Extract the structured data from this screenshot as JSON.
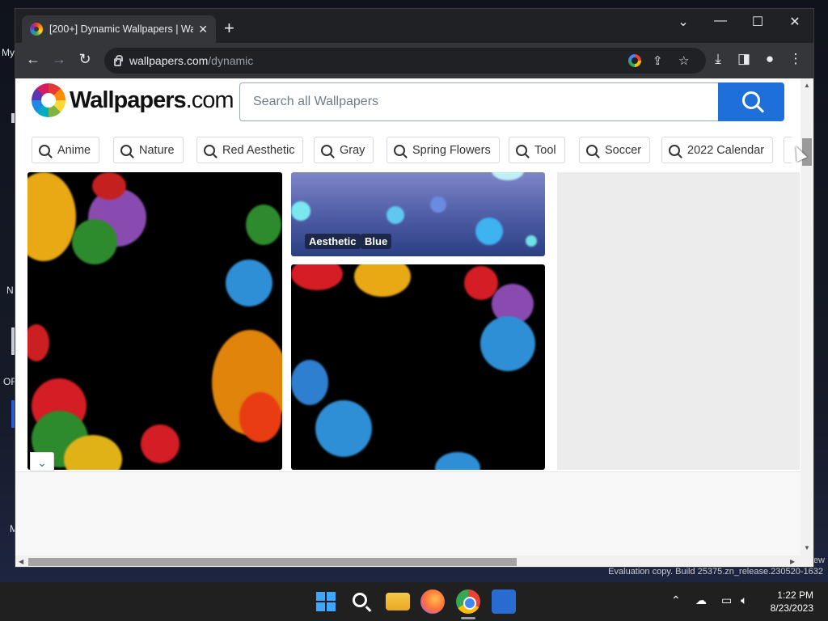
{
  "desktop": {
    "labels": [
      "My",
      "N",
      "OF",
      "M"
    ],
    "eval_right_text": "ew",
    "eval_text": "Evaluation copy. Build 25375.zn_release.230520-1632"
  },
  "browser": {
    "tab_title": "[200+] Dynamic Wallpapers | Wa",
    "tab_close": "✕",
    "new_tab": "+",
    "window_controls": {
      "dropdown": "⌄",
      "minimize": "—",
      "maximize": "☐",
      "close": "✕"
    },
    "url_host": "wallpapers.com",
    "url_path": "/dynamic"
  },
  "site": {
    "logo_main": "Wallpapers",
    "logo_suffix": ".com",
    "search_placeholder": "Search all Wallpapers",
    "chips": [
      {
        "label": "Anime"
      },
      {
        "label": "Nature"
      },
      {
        "label": "Red Aesthetic"
      },
      {
        "label": "Gray"
      },
      {
        "label": "Spring Flowers"
      },
      {
        "label": "Tool"
      },
      {
        "label": "Soccer"
      },
      {
        "label": "2022 Calendar"
      }
    ],
    "tile_tags": [
      "Aesthetic",
      "Blue"
    ],
    "collapse_glyph": "⌄"
  },
  "taskbar": {
    "time": "1:22 PM",
    "date": "8/23/2023"
  },
  "colors": {
    "accent": "#1e6fd9",
    "chrome_dark": "#202124",
    "chrome_toolbar": "#35363a"
  },
  "icons": [
    "back-icon",
    "forward-icon",
    "reload-icon",
    "lock-icon",
    "google-icon",
    "share-icon",
    "star-icon",
    "download-icon",
    "sidepanel-icon",
    "profile-icon",
    "menu-icon",
    "search-icon"
  ]
}
